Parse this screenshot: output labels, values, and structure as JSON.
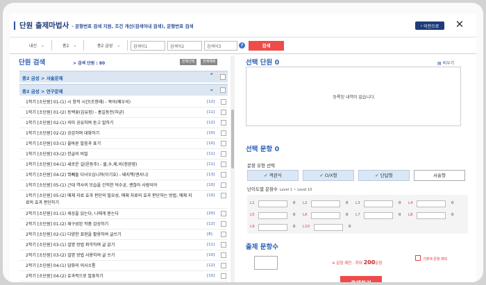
{
  "title": "단원 출제마법사",
  "subtitle": "- 문항번호 검색 지원, 조건 개선(검색어내 검색), 문항번호 검색",
  "prev_button": "이전으로",
  "close_icon": "✕",
  "filters": {
    "select1": "내신",
    "select2": "중2",
    "select3": "중2 금성",
    "search1_placeholder": "검색어1",
    "search2_placeholder": "검색어2",
    "search3_placeholder": "검색어3",
    "help": "?",
    "search_button": "검색"
  },
  "left": {
    "title": "단원 검색",
    "count_label": "> 검색 단원 : 80",
    "select_all": "전체선택",
    "deselect_all": "전체해제",
    "groups": [
      {
        "label": "중2 금성 > 서술문제",
        "arrow": "⌃"
      },
      {
        "label": "중2 금성 > 연구문제",
        "arrow": "⌄"
      }
    ],
    "items": [
      {
        "text": "1학기 [소단원] 01-(1) 시 창작 시간(조향래) - 북어(배우석)",
        "count": "[12]"
      },
      {
        "text": "1학기 [소단원] 01-(2) 등백꽃(김유정) - 홍길동전(허균)",
        "count": "[11]"
      },
      {
        "text": "1학기 [소단원] 02-(1) 의미 공유하며 듣고 말하기",
        "count": "[12]"
      },
      {
        "text": "1학기 [소단원] 02-(2) 공감하며 대화하기",
        "count": "[10]"
      },
      {
        "text": "1학기 [소단원] 03-(1) 올바른 발음과 표기",
        "count": "[10]"
      },
      {
        "text": "1학기 [소단원] 03-(2) 한글의 비밀",
        "count": "[11]"
      },
      {
        "text": "1학기 [소단원] 04-(1) 새로운 길(윤동주) - 물,수,제,비(정완영)",
        "count": "[11]"
      },
      {
        "text": "1학기 [소단원] 04-(2) 뛰뻬돌 다녀오십니까(이기호) - 돼지책(앤서니)",
        "count": "[13]"
      },
      {
        "text": "1학기 [소단원] 05-(1) 근대 역사의 모습을 간직한 덕수궁, 괜찮아 사람이야",
        "count": "[10]"
      },
      {
        "text": "1학기 [소단원] 05-(2) 매체 자료 효과 판단의 필요성, 매체 자료의 효과 판단하는 방법, 매체 자료의 효과 판단하기",
        "count": "[10]"
      },
      {
        "text": "2학기 [소단원] 01-(1) 세상을 읽는다, 나에게 묻는다",
        "count": "[20]"
      },
      {
        "text": "2학기 [소단원] 01-(2) 재구성된 작품 감상하기",
        "count": "[12]"
      },
      {
        "text": "2학기 [소단원] 02-(1) 다양한 표현을 활용하여 글쓰기",
        "count": "[8]"
      },
      {
        "text": "2학기 [소단원] 03-(1) 설명 방법 파악하며 글 읽기",
        "count": "[11]"
      },
      {
        "text": "2학기 [소단원] 03-(2) 설명 방법 사용하여 글 쓰기",
        "count": "[10]"
      },
      {
        "text": "2학기 [소단원] 04-(1) 담화의 의사소통",
        "count": "[12]"
      },
      {
        "text": "2학기 [소단원] 04-(2) 효과적으로 발표하기",
        "count": "[10]"
      }
    ]
  },
  "right": {
    "selected_unit_title": "선택 단원 0",
    "clear_link": "▤ 비우기",
    "empty_message": "등록된 내역이 없습니다.",
    "selected_question_title": "선택 문항 0",
    "type_label": "문항 유형 선택",
    "types": [
      {
        "label": "✓ 객관식",
        "on": true
      },
      {
        "label": "✓ O/X형",
        "on": true
      },
      {
        "label": "✓ 단답형",
        "on": true
      },
      {
        "label": "서술형",
        "on": false
      }
    ],
    "level_label": "난이도별 문항수",
    "level_range": "Level 1 ~ Level 10",
    "levels": [
      {
        "key": "L1",
        "value": "0"
      },
      {
        "key": "L2",
        "value": "0"
      },
      {
        "key": "L3",
        "value": "0"
      },
      {
        "key": "L4",
        "value": "0"
      },
      {
        "key": "L5",
        "value": "0"
      },
      {
        "key": "L6",
        "value": "0"
      },
      {
        "key": "L7",
        "value": "0"
      },
      {
        "key": "L8",
        "value": "0"
      },
      {
        "key": "L9",
        "value": "0"
      },
      {
        "key": "L10",
        "value": "0"
      }
    ],
    "question_count_title": "출제 문항수",
    "limit_prefix": "※ 문항 제한 : 최대 ",
    "limit_value": "200",
    "limit_suffix": "문항",
    "except_label": "기출제 문항 제외",
    "make_button": "출제하기"
  }
}
